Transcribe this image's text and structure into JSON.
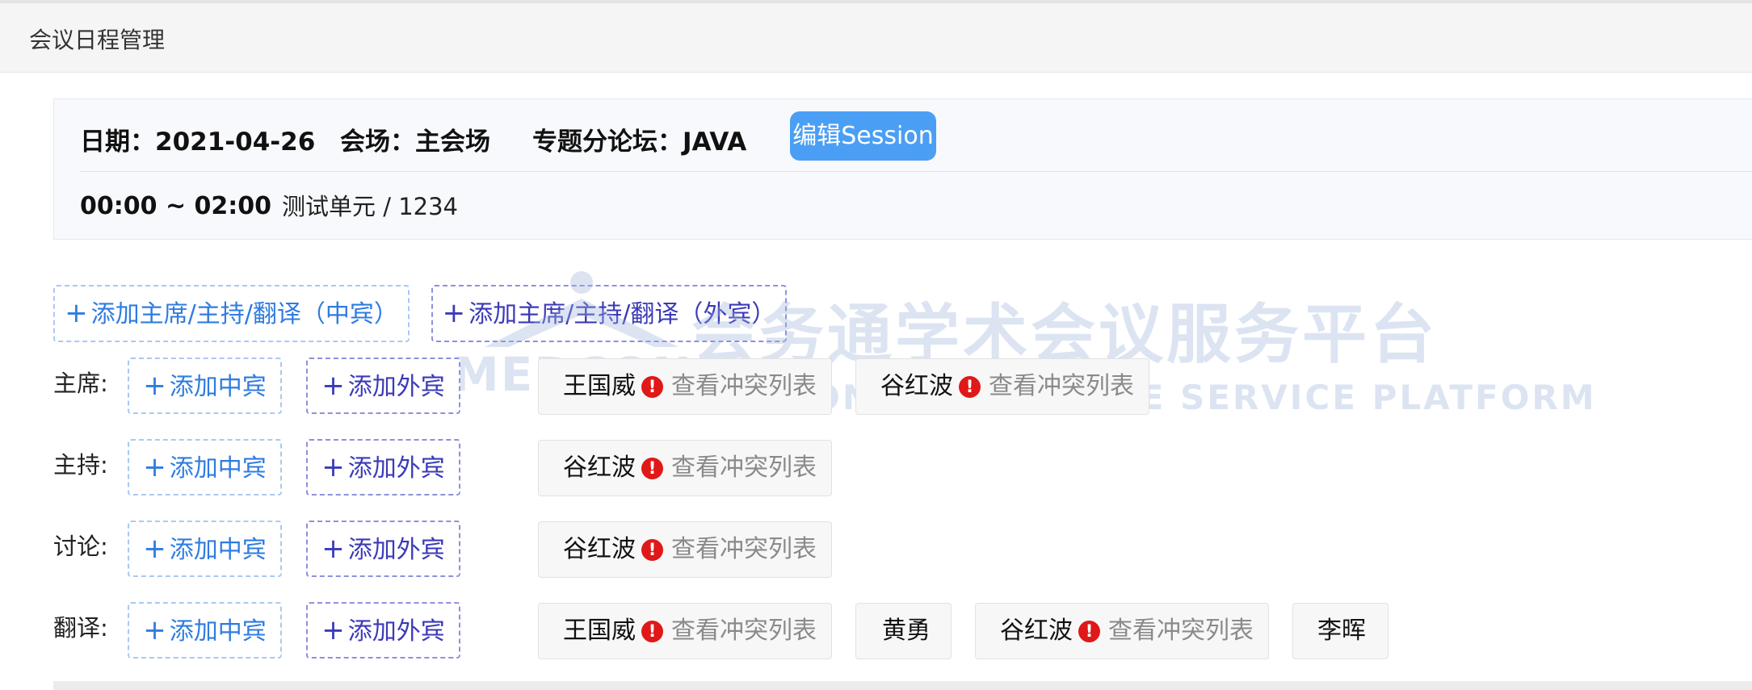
{
  "page": {
    "title": "会议日程管理"
  },
  "session": {
    "date": "日期：2021-04-26",
    "venue": "会场：主会场",
    "forum": "专题分论坛：JAVA",
    "edit_label": "编辑Session",
    "time": "00:00 ~ 02:00",
    "unit": "测试单元 / 1234"
  },
  "actions": {
    "add_all_cn": "添加主席/主持/翻译（中宾）",
    "add_all_fr": "添加主席/主持/翻译（外宾）"
  },
  "common": {
    "add_cn": "添加中宾",
    "add_fr": "添加外宾",
    "plus": "+",
    "alert": "!",
    "conflict": "查看冲突列表"
  },
  "roles": [
    {
      "label": "主席:",
      "people": [
        {
          "name": "王国威",
          "conflict": true
        },
        {
          "name": "谷红波",
          "conflict": true
        }
      ]
    },
    {
      "label": "主持:",
      "people": [
        {
          "name": "谷红波",
          "conflict": true
        }
      ]
    },
    {
      "label": "讨论:",
      "people": [
        {
          "name": "谷红波",
          "conflict": true
        }
      ]
    },
    {
      "label": "翻译:",
      "people": [
        {
          "name": "王国威",
          "conflict": true
        },
        {
          "name": "黄勇",
          "conflict": false
        },
        {
          "name": "谷红波",
          "conflict": true
        },
        {
          "name": "李晖",
          "conflict": false
        }
      ]
    }
  ],
  "watermark": {
    "logo": "MEDCON",
    "title": "会务通学术会议服务平台",
    "subtitle": "MEDCON CONFERENCE SERVICE PLATFORM"
  },
  "colors": {
    "accent": "#4a9ff5",
    "alert": "#e01818",
    "cn_border": "#a9c9f3",
    "fr_border": "#8e8fe0"
  }
}
